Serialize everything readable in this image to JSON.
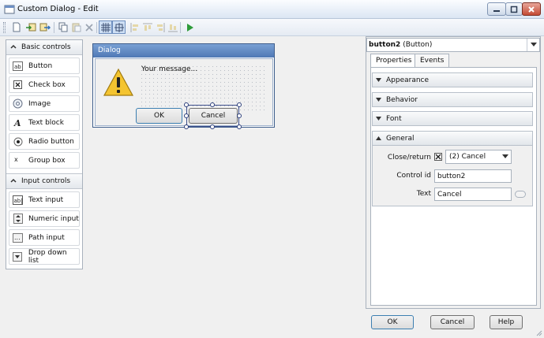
{
  "window": {
    "title": "Custom Dialog - Edit"
  },
  "toolbar": {
    "buttons": [
      "new-icon",
      "import-icon",
      "export-icon",
      "copy-icon",
      "paste-icon",
      "delete-icon",
      "grid-icon",
      "snap-icon",
      "align-left-icon",
      "align-top-icon",
      "align-right-icon",
      "align-bottom-icon",
      "run-icon"
    ]
  },
  "toolbox": {
    "basic_title": "Basic controls",
    "basic_items": [
      {
        "label": "Button",
        "icon": "button-icon"
      },
      {
        "label": "Check box",
        "icon": "checkbox-icon"
      },
      {
        "label": "Image",
        "icon": "image-icon"
      },
      {
        "label": "Text block",
        "icon": "text-block-icon"
      },
      {
        "label": "Radio button",
        "icon": "radio-icon"
      },
      {
        "label": "Group box",
        "icon": "group-box-icon"
      }
    ],
    "input_title": "Input controls",
    "input_items": [
      {
        "label": "Text input",
        "icon": "text-input-icon"
      },
      {
        "label": "Numeric input",
        "icon": "numeric-input-icon"
      },
      {
        "label": "Path input",
        "icon": "path-input-icon"
      },
      {
        "label": "Drop down list",
        "icon": "dropdown-icon"
      }
    ]
  },
  "dialog": {
    "title": "Dialog",
    "message": "Your message...",
    "ok_label": "OK",
    "cancel_label": "Cancel"
  },
  "properties": {
    "object_name": "button2",
    "object_type": "(Button)",
    "tabs": [
      "Properties",
      "Events"
    ],
    "groups": [
      "Appearance",
      "Behavior",
      "Font",
      "General"
    ],
    "close_return_label": "Close/return",
    "close_return_checked": true,
    "close_return_value": "(2) Cancel",
    "control_id_label": "Control id",
    "control_id_value": "button2",
    "text_label": "Text",
    "text_value": "Cancel"
  },
  "footer": {
    "ok": "OK",
    "cancel": "Cancel",
    "help": "Help"
  },
  "colors": {
    "accent": "#4f78b5",
    "titlebar": "#dbe6f3",
    "close": "#c44b34"
  }
}
